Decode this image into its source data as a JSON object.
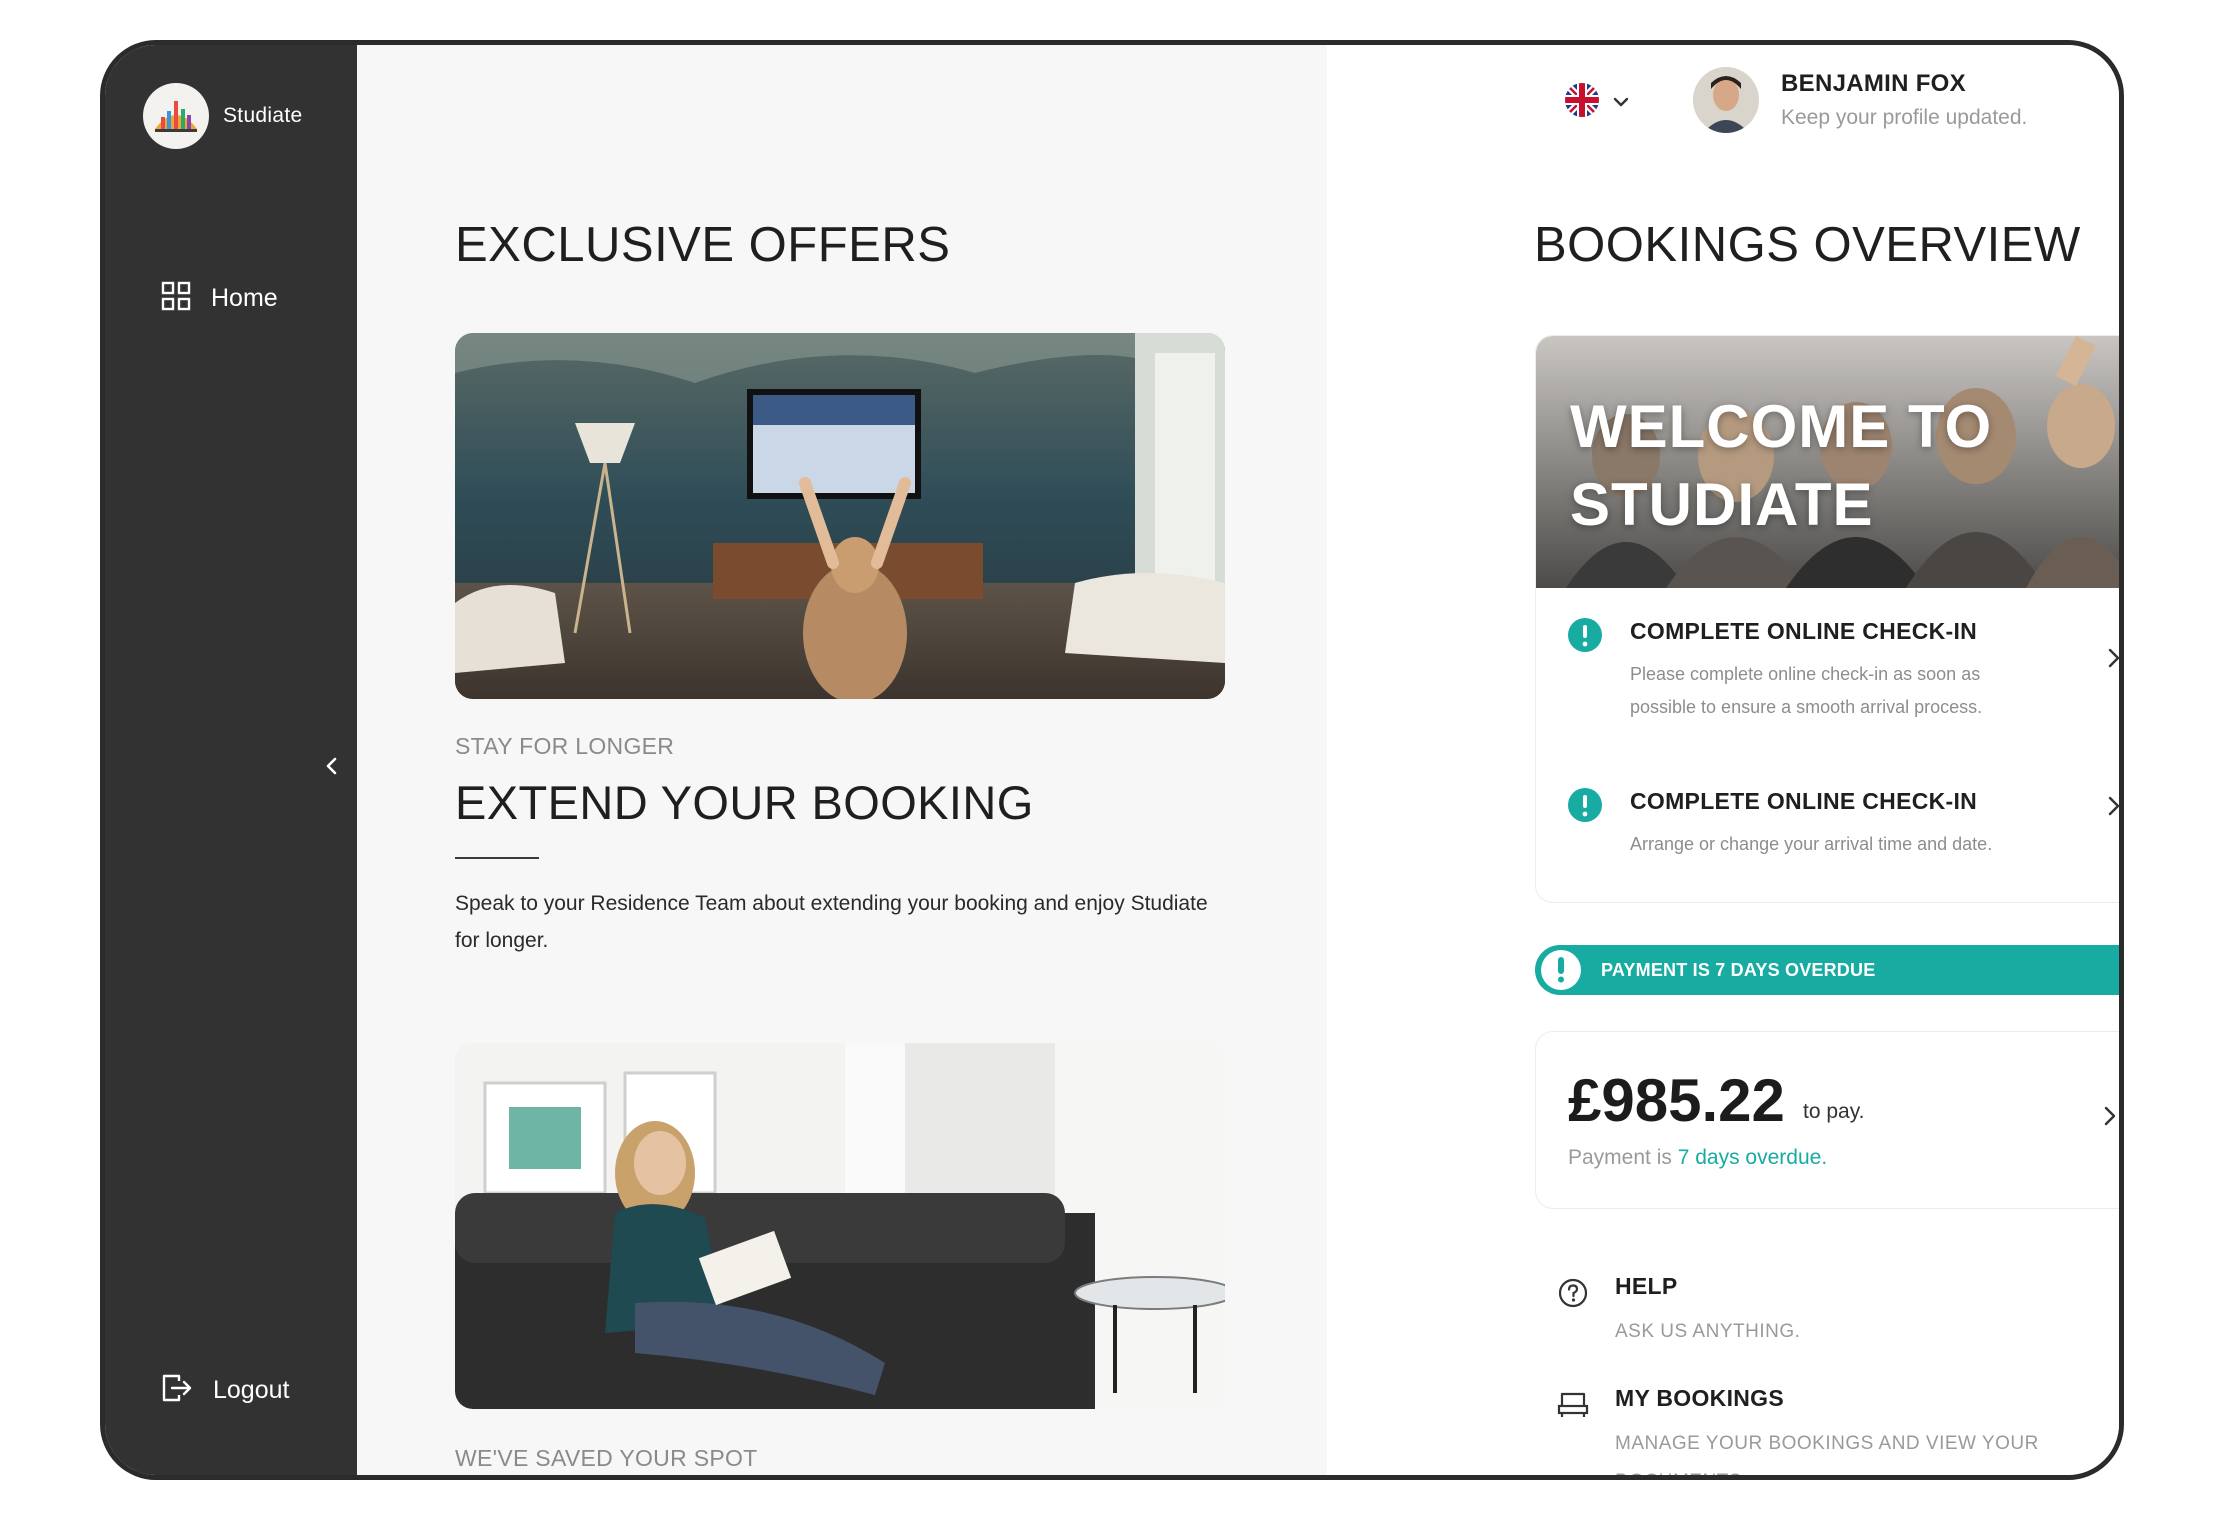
{
  "app": {
    "brand": "Studiate"
  },
  "sidebar": {
    "home_label": "Home",
    "logout_label": "Logout"
  },
  "header": {
    "language_flag": "uk-flag-icon",
    "user": {
      "name": "BENJAMIN FOX",
      "subtitle": "Keep your profile updated."
    }
  },
  "offers": {
    "title": "EXCLUSIVE OFFERS",
    "cards": [
      {
        "kicker": "STAY FOR LONGER",
        "title": "EXTEND YOUR BOOKING",
        "body": "Speak to your Residence Team about extending your booking and enjoy Studiate for longer."
      },
      {
        "kicker": "WE'VE SAVED YOUR SPOT"
      }
    ]
  },
  "bookings": {
    "title": "BOOKINGS OVERVIEW",
    "welcome": "WELCOME TO STUDIATE",
    "tasks": [
      {
        "title": "COMPLETE ONLINE CHECK-IN",
        "desc": "Please complete online check-in as soon as possible to ensure a smooth arrival process."
      },
      {
        "title": "COMPLETE ONLINE CHECK-IN",
        "desc": "Arrange or change your arrival time and date."
      }
    ],
    "overdue_banner": "PAYMENT IS 7 DAYS OVERDUE",
    "payment": {
      "amount": "£985.22",
      "suffix": "to pay.",
      "status_prefix": "Payment is",
      "status_link": "7 days overdue."
    },
    "links": [
      {
        "title": "HELP",
        "subtitle": "ASK US ANYTHING."
      },
      {
        "title": "MY BOOKINGS",
        "subtitle": "MANAGE YOUR BOOKINGS AND VIEW YOUR DOCUMENTS"
      }
    ]
  },
  "colors": {
    "accent": "#17aba2",
    "sidebar": "#323232",
    "offers_bg": "#f7f7f7"
  }
}
